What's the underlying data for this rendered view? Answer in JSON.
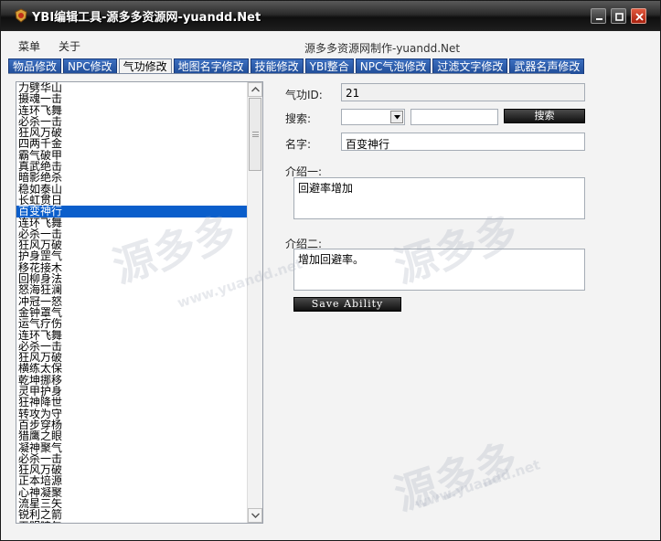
{
  "window": {
    "title": "YBI编辑工具-源多多资源网-yuandd.Net"
  },
  "menu": {
    "items": [
      "菜单",
      "关于"
    ],
    "credit": "源多多资源网制作-yuandd.Net"
  },
  "tabs": [
    "物品修改",
    "NPC修改",
    "气功修改",
    "地图名字修改",
    "技能修改",
    "YBI整合",
    "NPC气泡修改",
    "过滤文字修改",
    "武器名声修改"
  ],
  "active_tab": 2,
  "list": {
    "items": [
      "力劈华山",
      "摄魂一击",
      "连环飞舞",
      "必杀一击",
      "狂风万破",
      "四两千金",
      "霸气破甲",
      "真武绝击",
      "暗影绝杀",
      "稳如泰山",
      "长虹贯日",
      "百变神行",
      "连环飞舞",
      "必杀一击",
      "狂风万破",
      "护身罡气",
      "移花接木",
      "回柳身法",
      "怒海狂澜",
      "冲冠一怒",
      "金钟罩气",
      "运气疗伤",
      "连环飞舞",
      "必杀一击",
      "狂风万破",
      "横练太保",
      "乾坤挪移",
      "灵甲护身",
      "狂神降世",
      "转攻为守",
      "百步穿杨",
      "猎鹰之眼",
      "凝神聚气",
      "必杀一击",
      "狂风万破",
      "正本培源",
      "心神凝聚",
      "流星三矢",
      "锐利之箭",
      "无明暗矢"
    ],
    "selected_index": 11
  },
  "form": {
    "id_label": "气功ID:",
    "id_value": "21",
    "search_label": "搜索:",
    "search_select_value": "",
    "search_input_value": "",
    "search_button": "搜索",
    "name_label": "名字:",
    "name_value": "百变神行",
    "intro1_label": "介绍一:",
    "intro1_value": "回避率增加",
    "intro2_label": "介绍二:",
    "intro2_value": "增加回避率。",
    "save_button": "Save Ability"
  },
  "watermark": {
    "text": "源多多",
    "url": "www.yuandd.net"
  },
  "colors": {
    "tab_bg": "#2b5cad",
    "selection": "#0a5ecb",
    "titlebar": "#1a1a1a"
  }
}
